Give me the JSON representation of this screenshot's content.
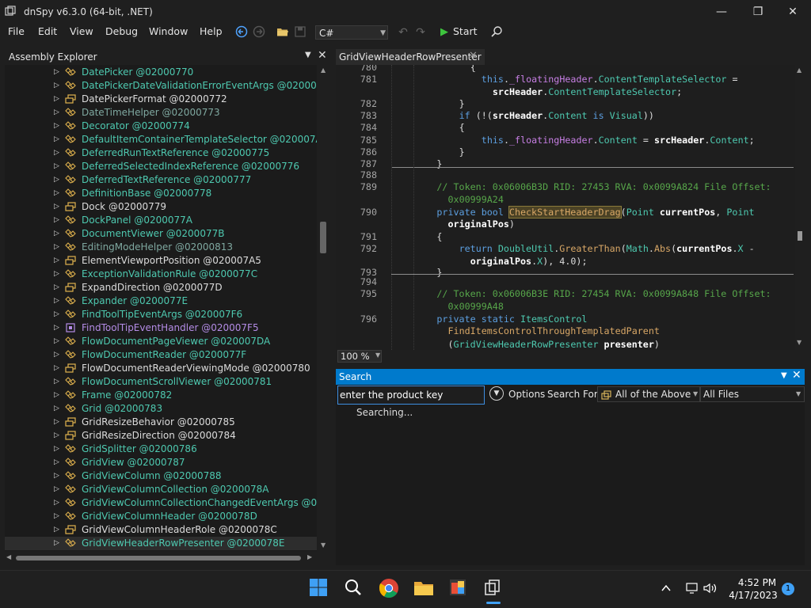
{
  "window": {
    "title": "dnSpy v6.3.0 (64-bit, .NET)",
    "minimize_glyph": "—",
    "maximize_glyph": "❐",
    "close_glyph": "✕"
  },
  "menu": [
    "File",
    "Edit",
    "View",
    "Debug",
    "Window",
    "Help"
  ],
  "toolbar": {
    "language": "C#",
    "start_label": "Start"
  },
  "assembly_explorer": {
    "title": "Assembly Explorer",
    "items": [
      {
        "label": "DatePicker @02000770",
        "color": "#4ec9b0",
        "icon": "class"
      },
      {
        "label": "DatePickerDateValidationErrorEventArgs @02000771",
        "color": "#4ec9b0",
        "icon": "class"
      },
      {
        "label": "DatePickerFormat @02000772",
        "color": "#dcdcdc",
        "icon": "enum"
      },
      {
        "label": "DateTimeHelper @02000773",
        "color": "#7fa8a0",
        "icon": "class"
      },
      {
        "label": "Decorator @02000774",
        "color": "#4ec9b0",
        "icon": "class"
      },
      {
        "label": "DefaultItemContainerTemplateSelector @020007A3",
        "color": "#4ec9b0",
        "icon": "class"
      },
      {
        "label": "DeferredRunTextReference @02000775",
        "color": "#4ec9b0",
        "icon": "class"
      },
      {
        "label": "DeferredSelectedIndexReference @02000776",
        "color": "#4ec9b0",
        "icon": "class"
      },
      {
        "label": "DeferredTextReference @02000777",
        "color": "#4ec9b0",
        "icon": "class"
      },
      {
        "label": "DefinitionBase @02000778",
        "color": "#4ec9b0",
        "icon": "class"
      },
      {
        "label": "Dock @02000779",
        "color": "#dcdcdc",
        "icon": "enum"
      },
      {
        "label": "DockPanel @0200077A",
        "color": "#4ec9b0",
        "icon": "class"
      },
      {
        "label": "DocumentViewer @0200077B",
        "color": "#4ec9b0",
        "icon": "class"
      },
      {
        "label": "EditingModeHelper @02000813",
        "color": "#7fa8a0",
        "icon": "class"
      },
      {
        "label": "ElementViewportPosition @020007A5",
        "color": "#dcdcdc",
        "icon": "enum"
      },
      {
        "label": "ExceptionValidationRule @0200077C",
        "color": "#4ec9b0",
        "icon": "class"
      },
      {
        "label": "ExpandDirection @0200077D",
        "color": "#dcdcdc",
        "icon": "enum"
      },
      {
        "label": "Expander @0200077E",
        "color": "#4ec9b0",
        "icon": "class"
      },
      {
        "label": "FindToolTipEventArgs @020007F6",
        "color": "#4ec9b0",
        "icon": "class"
      },
      {
        "label": "FindToolTipEventHandler @020007F5",
        "color": "#b48ce6",
        "icon": "delegate"
      },
      {
        "label": "FlowDocumentPageViewer @020007DA",
        "color": "#4ec9b0",
        "icon": "class"
      },
      {
        "label": "FlowDocumentReader @0200077F",
        "color": "#4ec9b0",
        "icon": "class"
      },
      {
        "label": "FlowDocumentReaderViewingMode @02000780",
        "color": "#dcdcdc",
        "icon": "enum"
      },
      {
        "label": "FlowDocumentScrollViewer @02000781",
        "color": "#4ec9b0",
        "icon": "class"
      },
      {
        "label": "Frame @02000782",
        "color": "#4ec9b0",
        "icon": "class"
      },
      {
        "label": "Grid @02000783",
        "color": "#4ec9b0",
        "icon": "class"
      },
      {
        "label": "GridResizeBehavior @02000785",
        "color": "#dcdcdc",
        "icon": "enum"
      },
      {
        "label": "GridResizeDirection @02000784",
        "color": "#dcdcdc",
        "icon": "enum"
      },
      {
        "label": "GridSplitter @02000786",
        "color": "#4ec9b0",
        "icon": "class"
      },
      {
        "label": "GridView @02000787",
        "color": "#4ec9b0",
        "icon": "class"
      },
      {
        "label": "GridViewColumn @02000788",
        "color": "#4ec9b0",
        "icon": "class"
      },
      {
        "label": "GridViewColumnCollection @0200078A",
        "color": "#4ec9b0",
        "icon": "class"
      },
      {
        "label": "GridViewColumnCollectionChangedEventArgs @0200078",
        "color": "#4ec9b0",
        "icon": "class"
      },
      {
        "label": "GridViewColumnHeader @0200078D",
        "color": "#4ec9b0",
        "icon": "class"
      },
      {
        "label": "GridViewColumnHeaderRole @0200078C",
        "color": "#dcdcdc",
        "icon": "enum"
      },
      {
        "label": "GridViewHeaderRowPresenter @0200078E",
        "color": "#4ec9b0",
        "icon": "class",
        "selected": true
      }
    ]
  },
  "editor": {
    "tab_label": "GridViewHeaderRowPresenter",
    "zoom": "100 %",
    "lines": [
      {
        "n": "780",
        "indent": 14,
        "segs": [
          {
            "t": "{",
            "c": "plain"
          }
        ]
      },
      {
        "n": "781",
        "indent": 16,
        "segs": [
          {
            "t": "this",
            "c": "kw"
          },
          {
            "t": ".",
            "c": "plain"
          },
          {
            "t": "_floatingHeader",
            "c": "fld"
          },
          {
            "t": ".",
            "c": "plain"
          },
          {
            "t": "ContentTemplateSelector",
            "c": "typ"
          },
          {
            "t": " =",
            "c": "plain"
          }
        ]
      },
      {
        "n": "",
        "indent": 18,
        "segs": [
          {
            "t": "srcHeader",
            "c": "par"
          },
          {
            "t": ".",
            "c": "plain"
          },
          {
            "t": "ContentTemplateSelector",
            "c": "typ"
          },
          {
            "t": ";",
            "c": "plain"
          }
        ]
      },
      {
        "n": "782",
        "indent": 12,
        "segs": [
          {
            "t": "}",
            "c": "plain"
          }
        ]
      },
      {
        "n": "783",
        "indent": 12,
        "segs": [
          {
            "t": "if",
            "c": "kw"
          },
          {
            "t": " (!(",
            "c": "plain"
          },
          {
            "t": "srcHeader",
            "c": "par"
          },
          {
            "t": ".",
            "c": "plain"
          },
          {
            "t": "Content",
            "c": "typ"
          },
          {
            "t": " ",
            "c": "plain"
          },
          {
            "t": "is",
            "c": "kw"
          },
          {
            "t": " ",
            "c": "plain"
          },
          {
            "t": "Visual",
            "c": "cls"
          },
          {
            "t": "))",
            "c": "plain"
          }
        ]
      },
      {
        "n": "784",
        "indent": 12,
        "segs": [
          {
            "t": "{",
            "c": "plain"
          }
        ]
      },
      {
        "n": "785",
        "indent": 16,
        "segs": [
          {
            "t": "this",
            "c": "kw"
          },
          {
            "t": ".",
            "c": "plain"
          },
          {
            "t": "_floatingHeader",
            "c": "fld"
          },
          {
            "t": ".",
            "c": "plain"
          },
          {
            "t": "Content",
            "c": "typ"
          },
          {
            "t": " = ",
            "c": "plain"
          },
          {
            "t": "srcHeader",
            "c": "par"
          },
          {
            "t": ".",
            "c": "plain"
          },
          {
            "t": "Content",
            "c": "typ"
          },
          {
            "t": ";",
            "c": "plain"
          }
        ]
      },
      {
        "n": "786",
        "indent": 12,
        "segs": [
          {
            "t": "}",
            "c": "plain"
          }
        ]
      },
      {
        "n": "787",
        "indent": 8,
        "segs": [
          {
            "t": "}",
            "c": "plain"
          }
        ]
      },
      {
        "n": "788",
        "indent": 0,
        "segs": [],
        "sep_above": true
      },
      {
        "n": "789",
        "indent": 8,
        "segs": [
          {
            "t": "// Token: 0x06006B3D RID: 27453 RVA: 0x0099A824 File Offset:",
            "c": "cmt"
          }
        ]
      },
      {
        "n": "",
        "indent": 10,
        "segs": [
          {
            "t": "0x00999A24",
            "c": "cmt"
          }
        ]
      },
      {
        "n": "790",
        "indent": 8,
        "segs": [
          {
            "t": "private",
            "c": "kw"
          },
          {
            "t": " ",
            "c": "plain"
          },
          {
            "t": "bool",
            "c": "kw"
          },
          {
            "t": " ",
            "c": "plain"
          },
          {
            "t": "CheckStartHeaderDrag",
            "c": "hl"
          },
          {
            "t": "(",
            "c": "plain"
          },
          {
            "t": "Point",
            "c": "cls"
          },
          {
            "t": " ",
            "c": "plain"
          },
          {
            "t": "currentPos",
            "c": "par"
          },
          {
            "t": ", ",
            "c": "plain"
          },
          {
            "t": "Point",
            "c": "cls"
          }
        ]
      },
      {
        "n": "",
        "indent": 10,
        "segs": [
          {
            "t": "originalPos",
            "c": "par"
          },
          {
            "t": ")",
            "c": "plain"
          }
        ]
      },
      {
        "n": "791",
        "indent": 8,
        "segs": [
          {
            "t": "{",
            "c": "plain"
          }
        ]
      },
      {
        "n": "792",
        "indent": 12,
        "segs": [
          {
            "t": "return",
            "c": "kw"
          },
          {
            "t": " ",
            "c": "plain"
          },
          {
            "t": "DoubleUtil",
            "c": "cls"
          },
          {
            "t": ".",
            "c": "plain"
          },
          {
            "t": "GreaterThan",
            "c": "mth"
          },
          {
            "t": "(",
            "c": "plain"
          },
          {
            "t": "Math",
            "c": "cls"
          },
          {
            "t": ".",
            "c": "plain"
          },
          {
            "t": "Abs",
            "c": "mth"
          },
          {
            "t": "(",
            "c": "plain"
          },
          {
            "t": "currentPos",
            "c": "par"
          },
          {
            "t": ".",
            "c": "plain"
          },
          {
            "t": "X",
            "c": "typ"
          },
          {
            "t": " -",
            "c": "plain"
          }
        ]
      },
      {
        "n": "",
        "indent": 14,
        "segs": [
          {
            "t": "originalPos",
            "c": "par"
          },
          {
            "t": ".",
            "c": "plain"
          },
          {
            "t": "X",
            "c": "typ"
          },
          {
            "t": "), 4.0);",
            "c": "plain"
          }
        ]
      },
      {
        "n": "793",
        "indent": 8,
        "segs": [
          {
            "t": "}",
            "c": "plain"
          }
        ]
      },
      {
        "n": "794",
        "indent": 0,
        "segs": [],
        "sep_above": true
      },
      {
        "n": "795",
        "indent": 8,
        "segs": [
          {
            "t": "// Token: 0x06006B3E RID: 27454 RVA: 0x0099A848 File Offset:",
            "c": "cmt"
          }
        ]
      },
      {
        "n": "",
        "indent": 10,
        "segs": [
          {
            "t": "0x00999A48",
            "c": "cmt"
          }
        ]
      },
      {
        "n": "796",
        "indent": 8,
        "segs": [
          {
            "t": "private",
            "c": "kw"
          },
          {
            "t": " ",
            "c": "plain"
          },
          {
            "t": "static",
            "c": "kw"
          },
          {
            "t": " ",
            "c": "plain"
          },
          {
            "t": "ItemsControl",
            "c": "cls"
          }
        ]
      },
      {
        "n": "",
        "indent": 10,
        "segs": [
          {
            "t": "FindItemsControlThroughTemplatedParent",
            "c": "mth"
          }
        ]
      },
      {
        "n": "",
        "indent": 10,
        "segs": [
          {
            "t": "(",
            "c": "plain"
          },
          {
            "t": "GridViewHeaderRowPresenter",
            "c": "cls"
          },
          {
            "t": " ",
            "c": "plain"
          },
          {
            "t": "presenter",
            "c": "par"
          },
          {
            "t": ")",
            "c": "plain"
          }
        ]
      },
      {
        "n": "797",
        "indent": 8,
        "segs": [
          {
            "t": "{",
            "c": "plain"
          }
        ]
      }
    ]
  },
  "search": {
    "title": "Search",
    "query": "enter the product key",
    "options_label": "Options",
    "search_for_label": "Search For:",
    "search_for_value": "All of the Above",
    "files_value": "All Files",
    "status": "Searching..."
  },
  "taskbar": {
    "time": "4:52 PM",
    "date": "4/17/2023",
    "notifications": "1"
  }
}
